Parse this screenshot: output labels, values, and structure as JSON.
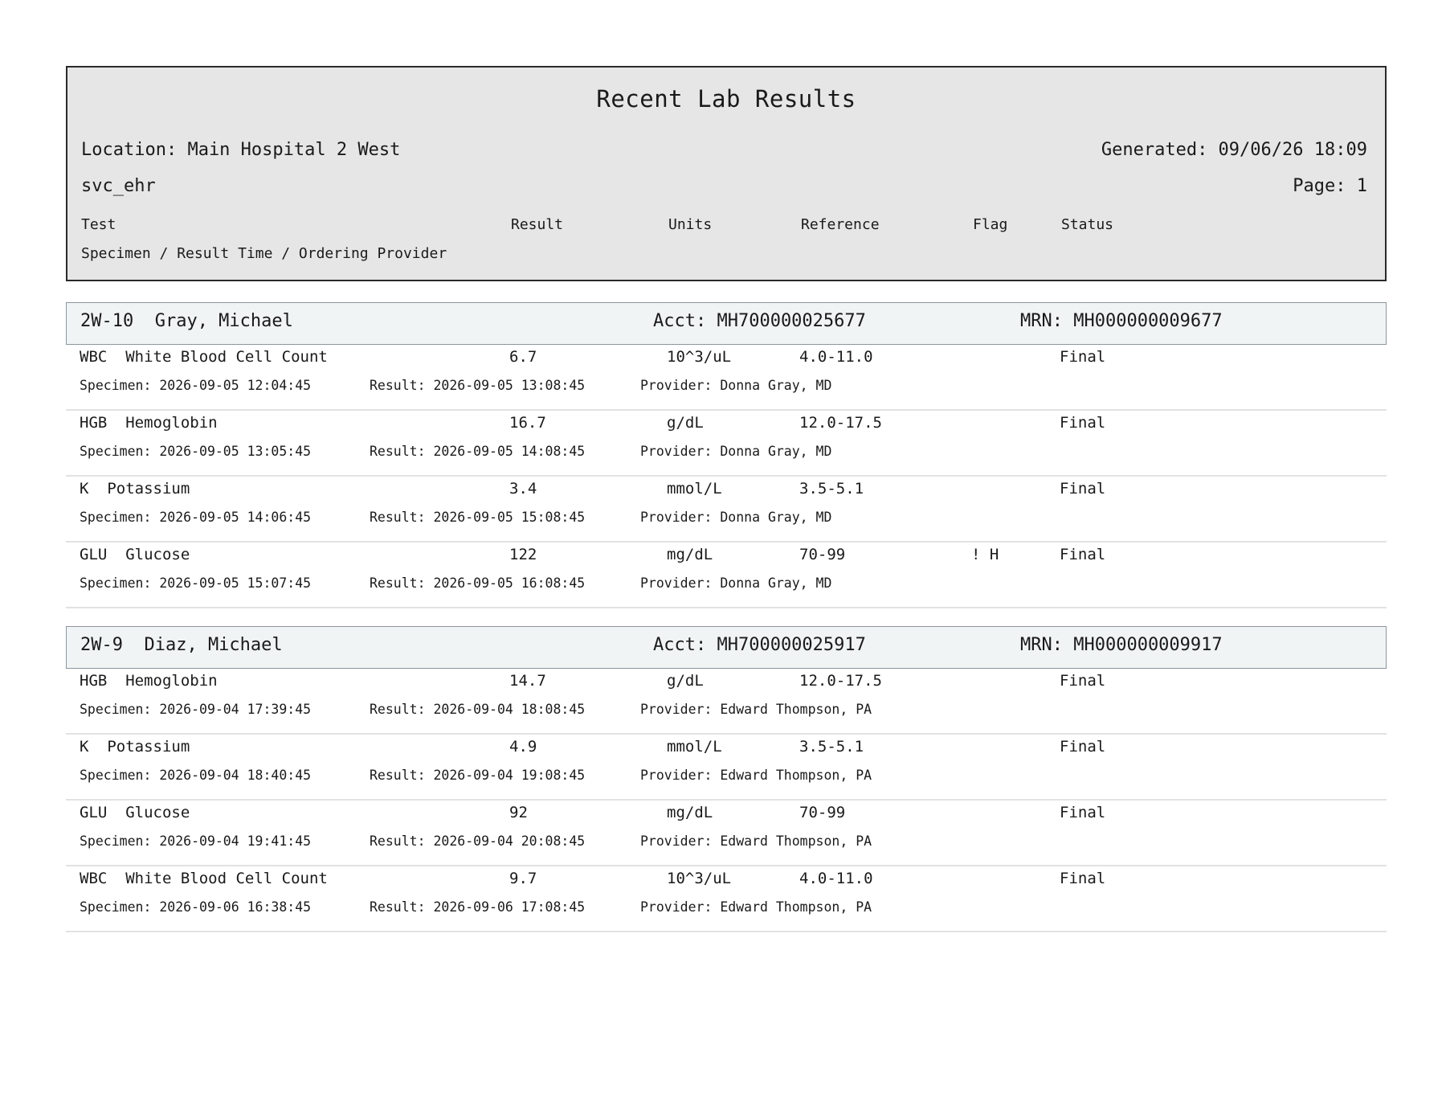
{
  "report": {
    "title": "Recent Lab Results",
    "location": "Location: Main Hospital 2 West",
    "generated": "Generated: 09/06/26 18:09",
    "user": "svc_ehr",
    "page": "Page: 1",
    "columns": {
      "test": "Test",
      "result": "Result",
      "units": "Units",
      "reference": "Reference",
      "flag": "Flag",
      "status": "Status"
    },
    "subheader": "Specimen / Result Time / Ordering Provider"
  },
  "patients": [
    {
      "room_name": "2W-10  Gray, Michael",
      "acct": "Acct: MH700000025677",
      "mrn": "MRN: MH000000009677",
      "results": [
        {
          "test": "WBC  White Blood Cell Count",
          "result": "6.7",
          "units": "10^3/uL",
          "reference": "4.0-11.0",
          "flag": "",
          "status": "Final",
          "specimen": "Specimen: 2026-09-05 12:04:45",
          "result_time": "Result: 2026-09-05 13:08:45",
          "provider": "Provider: Donna Gray, MD"
        },
        {
          "test": "HGB  Hemoglobin",
          "result": "16.7",
          "units": "g/dL",
          "reference": "12.0-17.5",
          "flag": "",
          "status": "Final",
          "specimen": "Specimen: 2026-09-05 13:05:45",
          "result_time": "Result: 2026-09-05 14:08:45",
          "provider": "Provider: Donna Gray, MD"
        },
        {
          "test": "K  Potassium",
          "result": "3.4",
          "units": "mmol/L",
          "reference": "3.5-5.1",
          "flag": "",
          "status": "Final",
          "specimen": "Specimen: 2026-09-05 14:06:45",
          "result_time": "Result: 2026-09-05 15:08:45",
          "provider": "Provider: Donna Gray, MD"
        },
        {
          "test": "GLU  Glucose",
          "result": "122",
          "units": "mg/dL",
          "reference": "70-99",
          "flag": "! H",
          "status": "Final",
          "specimen": "Specimen: 2026-09-05 15:07:45",
          "result_time": "Result: 2026-09-05 16:08:45",
          "provider": "Provider: Donna Gray, MD"
        }
      ]
    },
    {
      "room_name": "2W-9  Diaz, Michael",
      "acct": "Acct: MH700000025917",
      "mrn": "MRN: MH000000009917",
      "results": [
        {
          "test": "HGB  Hemoglobin",
          "result": "14.7",
          "units": "g/dL",
          "reference": "12.0-17.5",
          "flag": "",
          "status": "Final",
          "specimen": "Specimen: 2026-09-04 17:39:45",
          "result_time": "Result: 2026-09-04 18:08:45",
          "provider": "Provider: Edward Thompson, PA"
        },
        {
          "test": "K  Potassium",
          "result": "4.9",
          "units": "mmol/L",
          "reference": "3.5-5.1",
          "flag": "",
          "status": "Final",
          "specimen": "Specimen: 2026-09-04 18:40:45",
          "result_time": "Result: 2026-09-04 19:08:45",
          "provider": "Provider: Edward Thompson, PA"
        },
        {
          "test": "GLU  Glucose",
          "result": "92",
          "units": "mg/dL",
          "reference": "70-99",
          "flag": "",
          "status": "Final",
          "specimen": "Specimen: 2026-09-04 19:41:45",
          "result_time": "Result: 2026-09-04 20:08:45",
          "provider": "Provider: Edward Thompson, PA"
        },
        {
          "test": "WBC  White Blood Cell Count",
          "result": "9.7",
          "units": "10^3/uL",
          "reference": "4.0-11.0",
          "flag": "",
          "status": "Final",
          "specimen": "Specimen: 2026-09-06 16:38:45",
          "result_time": "Result: 2026-09-06 17:08:45",
          "provider": "Provider: Edward Thompson, PA"
        }
      ]
    }
  ]
}
